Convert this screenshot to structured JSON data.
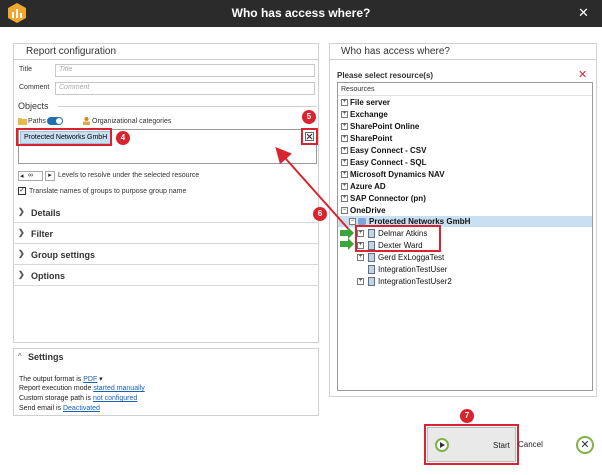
{
  "window": {
    "title": "Who has access where?"
  },
  "left": {
    "header": "Report configuration",
    "title_label": "Title",
    "title_placeholder": "Title",
    "comment_label": "Comment",
    "comment_placeholder": "Comment",
    "objects_header": "Objects",
    "paths_label": "Paths",
    "org_label": "Organizational categories",
    "selected_object": "Protected Networks GmbH",
    "levels_value": "∞",
    "levels_label": "Levels to resolve under the selected resource",
    "translate_label": "Translate names of groups to purpose group name",
    "translate_checked": true,
    "sections": [
      "Details",
      "Filter",
      "Group settings",
      "Options"
    ],
    "settings": {
      "header": "Settings",
      "output_prefix": "The output format is",
      "output_value": "PDF",
      "mode_prefix": "Report execution mode",
      "mode_value": "started manually",
      "storage_prefix": "Custom storage path is",
      "storage_value": "not configured",
      "email_prefix": "Send email is",
      "email_value": "Deactivated"
    }
  },
  "right": {
    "header": "Who has access where?",
    "subheader": "Please select resource(s)",
    "column": "Resources",
    "resources": [
      "File server",
      "Exchange",
      "SharePoint Online",
      "SharePoint",
      "Easy Connect - CSV",
      "Easy Connect - SQL",
      "Microsoft Dynamics NAV",
      "Azure AD",
      "SAP Connector (pn)",
      "OneDrive"
    ],
    "onedrive_child": "Protected Networks GmbH",
    "users": [
      "Delmar Atkins",
      "Dexter Ward",
      "Gerd ExLoggaTest",
      "IntegrationTestUser",
      "IntegrationTestUser2"
    ]
  },
  "footer": {
    "start": "Start",
    "cancel": "Cancel"
  },
  "badges": [
    "4",
    "5",
    "6",
    "7"
  ],
  "colors": {
    "accent": "#1a5fb4",
    "highlight_red": "#d9232e",
    "selection": "#c9dff2",
    "arrow_green": "#3aa63a"
  }
}
